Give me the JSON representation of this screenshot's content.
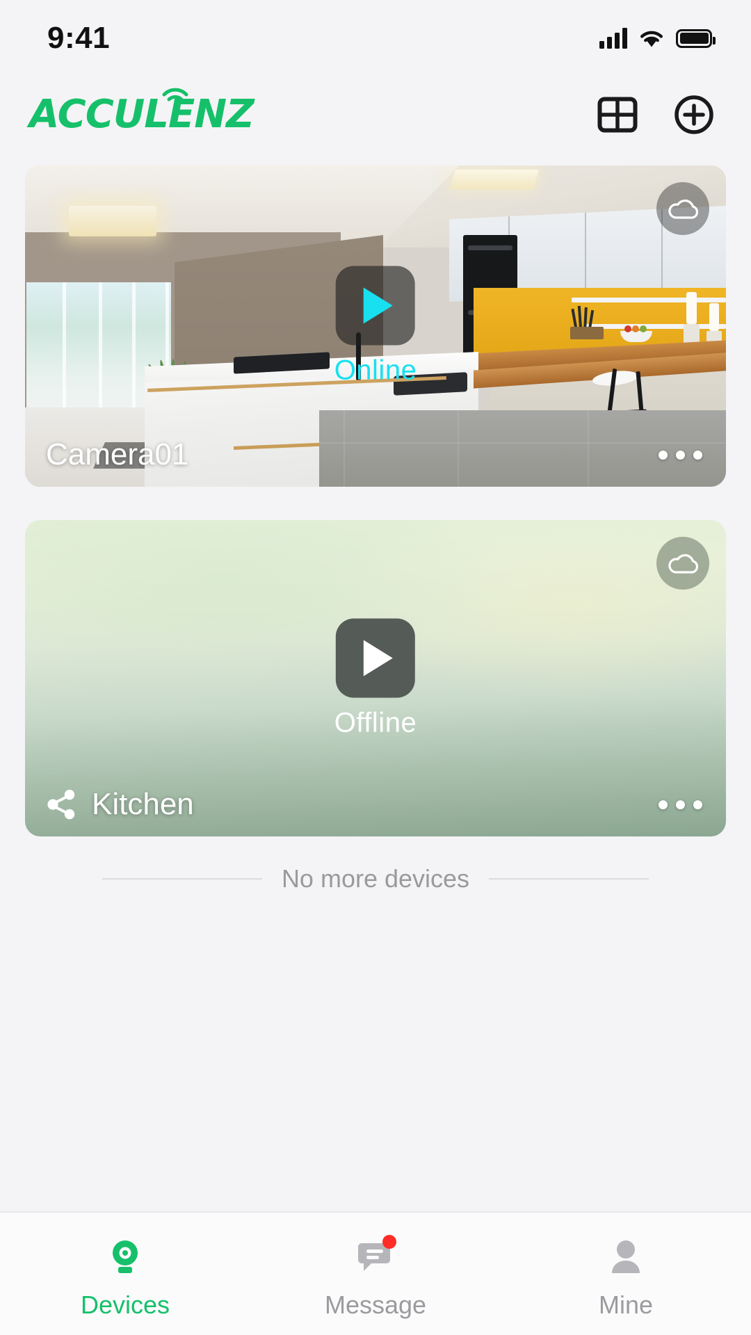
{
  "status_bar": {
    "time": "9:41",
    "signal_icon": "cellular-signal-icon",
    "wifi_icon": "wifi-icon",
    "battery_icon": "battery-full-icon"
  },
  "header": {
    "logo_text": "ACCULENZ",
    "logo_color": "#16c06a",
    "grid_view_icon": "grid-view-icon",
    "add_icon": "add-circle-icon"
  },
  "devices": [
    {
      "name": "Camera01",
      "status": "Online",
      "status_color": "#19e0f0",
      "cloud_icon": "cloud-icon",
      "play_icon": "play-icon",
      "more_icon": "more-options-icon",
      "shared": false,
      "thumbnail": "kitchen-photo"
    },
    {
      "name": "Kitchen",
      "status": "Offline",
      "status_color": "#ffffff",
      "cloud_icon": "cloud-icon",
      "play_icon": "play-icon",
      "more_icon": "more-options-icon",
      "shared": true,
      "share_icon": "share-icon",
      "thumbnail": "sage-gradient-placeholder"
    }
  ],
  "list_footer": {
    "text": "No more devices"
  },
  "tab_bar": {
    "active_color": "#16c06a",
    "inactive_color": "#9b9b9f",
    "badge_color": "#ff2d26",
    "tabs": [
      {
        "label": "Devices",
        "icon": "camera-icon",
        "active": true,
        "badge": false
      },
      {
        "label": "Message",
        "icon": "message-icon",
        "active": false,
        "badge": true
      },
      {
        "label": "Mine",
        "icon": "person-icon",
        "active": false,
        "badge": false
      }
    ]
  }
}
